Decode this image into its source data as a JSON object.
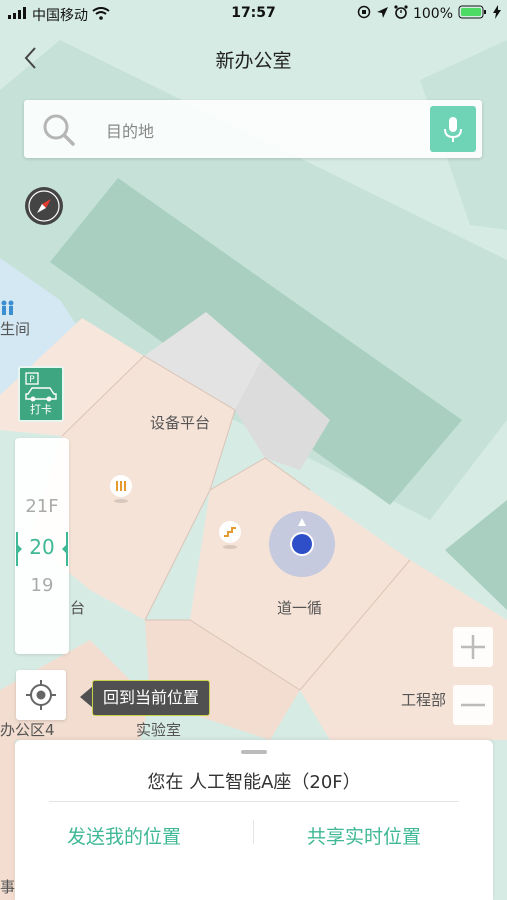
{
  "status_bar": {
    "carrier": "中国移动",
    "time": "17:57",
    "battery": "100%"
  },
  "nav": {
    "title": "新办公室"
  },
  "search": {
    "placeholder": "目的地"
  },
  "parking": {
    "label": "打卡"
  },
  "floors": {
    "items": [
      "21F",
      "20",
      "19"
    ],
    "selected": "20"
  },
  "locate_tooltip": "回到当前位置",
  "map_labels": {
    "restroom_partial": "生间",
    "equipment_platform": "设备平台",
    "daoyixun": "道一循",
    "platform_partial": "台",
    "engineering": "工程部",
    "office_area": "办公区4",
    "lab": "实验室",
    "bottom_partial": "事业"
  },
  "zoom": {
    "in": "+",
    "out": "−"
  },
  "bottom_sheet": {
    "location_text": "您在 人工智能A座（20F）",
    "send_location": "发送我的位置",
    "share_live_location": "共享实时位置"
  },
  "colors": {
    "accent": "#3fb895",
    "mic_bg": "#6fd3b5",
    "parking_bg": "#3fa682",
    "tooltip_bg": "#505050"
  },
  "icons": {
    "back": "chevron-left-icon",
    "search": "search-icon",
    "mic": "microphone-icon",
    "compass": "compass-icon",
    "parking": "car-icon",
    "locate": "crosshair-icon"
  }
}
